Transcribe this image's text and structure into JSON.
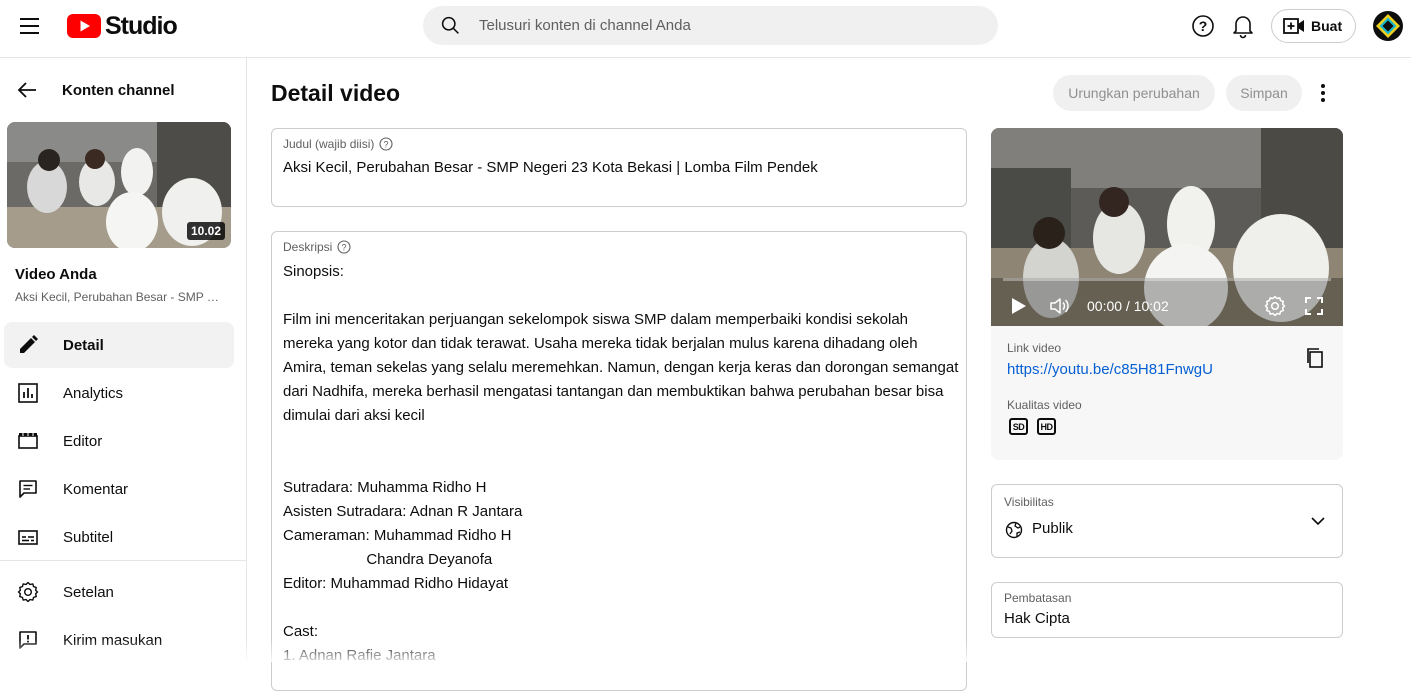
{
  "header": {
    "logo_text": "Studio",
    "search_placeholder": "Telusuri konten di channel Anda",
    "create_label": "Buat"
  },
  "sidebar": {
    "back_label": "Konten channel",
    "thumbnail_duration": "10.02",
    "your_video_label": "Video Anda",
    "video_title": "Aksi Kecil, Perubahan Besar - SMP Negeri 23 Kota Bekasi | Lomba Film Pendek",
    "items": [
      {
        "label": "Detail",
        "icon": "pencil-icon",
        "active": true
      },
      {
        "label": "Analytics",
        "icon": "analytics-icon",
        "active": false
      },
      {
        "label": "Editor",
        "icon": "editor-clapper-icon",
        "active": false
      },
      {
        "label": "Komentar",
        "icon": "comment-icon",
        "active": false
      },
      {
        "label": "Subtitel",
        "icon": "subtitles-icon",
        "active": false
      },
      {
        "label": "Setelan",
        "icon": "gear-icon",
        "active": false
      },
      {
        "label": "Kirim masukan",
        "icon": "feedback-icon",
        "active": false
      }
    ]
  },
  "main": {
    "page_title": "Detail video",
    "undo_label": "Urungkan perubahan",
    "save_label": "Simpan",
    "title_field": {
      "label": "Judul (wajib diisi)",
      "value": "Aksi Kecil, Perubahan Besar  - SMP Negeri 23 Kota Bekasi | Lomba Film Pendek"
    },
    "description_field": {
      "label": "Deskripsi",
      "value": "Sinopsis:\n\nFilm ini menceritakan perjuangan sekelompok siswa SMP dalam memperbaiki kondisi sekolah\nmereka yang kotor dan tidak terawat. Usaha mereka tidak berjalan mulus karena dihadang oleh\nAmira, teman sekelas yang selalu meremehkan. Namun, dengan kerja keras dan dorongan semangat\ndari Nadhifa, mereka berhasil mengatasi tantangan dan membuktikan bahwa perubahan besar bisa\ndimulai dari aksi kecil\n\n\nSutradara: Muhamma Ridho H\nAsisten Sutradara: Adnan R Jantara\nCameraman: Muhammad Ridho H\n                    Chandra Deyanofa\nEditor: Muhammad Ridho Hidayat\n\nCast:\n1. Adnan Rafie Jantara"
    }
  },
  "player": {
    "time": "00:00 / 10:02",
    "progress": 0
  },
  "video_info": {
    "link_label": "Link video",
    "link_url": "https://youtu.be/c85H81FnwgU",
    "quality_label": "Kualitas video",
    "qualities": [
      "SD",
      "HD"
    ]
  },
  "visibility": {
    "label": "Visibilitas",
    "value": "Publik"
  },
  "restrictions": {
    "label": "Pembatasan",
    "value": "Hak Cipta"
  },
  "colors": {
    "accent_red": "#ff0000",
    "link_blue": "#065fd4"
  }
}
